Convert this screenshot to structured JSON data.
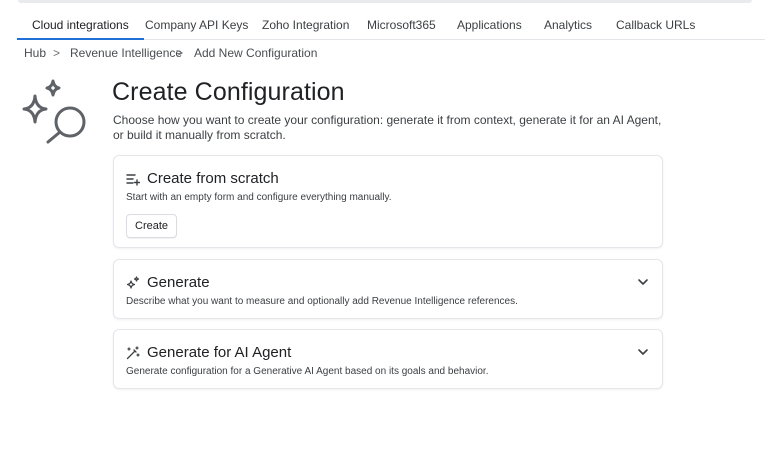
{
  "tabs": [
    {
      "label": "Cloud integrations",
      "active": true
    },
    {
      "label": "Company API Keys"
    },
    {
      "label": "Zoho Integration"
    },
    {
      "label": "Microsoft365"
    },
    {
      "label": "Applications"
    },
    {
      "label": "Analytics"
    },
    {
      "label": "Callback URLs"
    }
  ],
  "breadcrumb": {
    "items": [
      "Hub",
      "Revenue Intelligence",
      "Add New Configuration"
    ],
    "separator": ">"
  },
  "page": {
    "title": "Create Configuration",
    "description": "Choose how you want to create your configuration: generate it from context, generate it for an AI Agent, or build it manually from scratch.",
    "hero_icon": "sparkle-search-icon"
  },
  "cards": {
    "scratch": {
      "title": "Create from scratch",
      "description": "Start with an empty form and configure everything manually.",
      "button_label": "Create",
      "icon": "list-add-icon"
    },
    "generate": {
      "title": "Generate",
      "description": "Describe what you want to measure and optionally add Revenue Intelligence references.",
      "icon": "sparkles-icon",
      "expanded": false
    },
    "ai_agent": {
      "title": "Generate for AI Agent",
      "description": "Generate configuration for a Generative AI Agent based on its goals and behavior.",
      "icon": "magic-wand-icon",
      "expanded": false
    }
  },
  "colors": {
    "active_tab_underline": "#1f6fd6",
    "border": "#e4e6ea",
    "text": "#202124"
  }
}
